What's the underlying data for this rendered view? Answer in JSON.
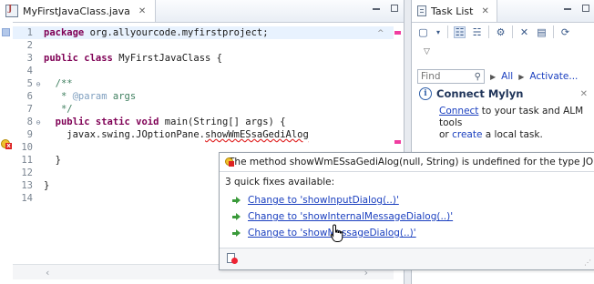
{
  "editor": {
    "tab_label": "MyFirstJavaClass.java",
    "tab_close": "✕",
    "lines": [
      {
        "n": "1",
        "fold": "",
        "segments": [
          {
            "t": "package ",
            "c": "kw"
          },
          {
            "t": "org.allyourcode.myfirstproject;",
            "c": ""
          }
        ]
      },
      {
        "n": "2",
        "fold": "",
        "segments": []
      },
      {
        "n": "3",
        "fold": "",
        "segments": [
          {
            "t": "public class ",
            "c": "kw"
          },
          {
            "t": "MyFirstJavaClass {",
            "c": ""
          }
        ]
      },
      {
        "n": "4",
        "fold": "",
        "segments": []
      },
      {
        "n": "5",
        "fold": "⊖",
        "segments": [
          {
            "t": "  /**",
            "c": "cm"
          }
        ]
      },
      {
        "n": "6",
        "fold": "",
        "segments": [
          {
            "t": "   * ",
            "c": "cm"
          },
          {
            "t": "@param",
            "c": "ann"
          },
          {
            "t": " args",
            "c": "cm"
          }
        ]
      },
      {
        "n": "7",
        "fold": "",
        "segments": [
          {
            "t": "   */",
            "c": "cm"
          }
        ]
      },
      {
        "n": "8",
        "fold": "⊖",
        "segments": [
          {
            "t": "  public static void ",
            "c": "kw"
          },
          {
            "t": "main(String[] args) {",
            "c": ""
          }
        ]
      },
      {
        "n": "9",
        "fold": "",
        "segments": [
          {
            "t": "    javax.swing.JOptionPane.",
            "c": ""
          },
          {
            "t": "showWmESsaGediAlog",
            "c": "err"
          }
        ]
      },
      {
        "n": "10",
        "fold": "",
        "segments": []
      },
      {
        "n": "11",
        "fold": "",
        "segments": [
          {
            "t": "  }",
            "c": ""
          }
        ]
      },
      {
        "n": "12",
        "fold": "",
        "segments": []
      },
      {
        "n": "13",
        "fold": "",
        "segments": [
          {
            "t": "}",
            "c": ""
          }
        ]
      },
      {
        "n": "14",
        "fold": "",
        "segments": []
      }
    ]
  },
  "tasklist": {
    "tab_label": "Task List",
    "tab_close": "✕",
    "find_placeholder": "Find",
    "all_label": "All",
    "activate_label": "Activate...",
    "mylyn": {
      "title": "Connect Mylyn",
      "close": "✕",
      "connect_link": "Connect",
      "text1": " to your task and ALM tools",
      "or_text": "or ",
      "create_link": "create",
      "text2": " a local task."
    }
  },
  "quickfix": {
    "message": "The method showWmESsaGediAlog(null, String) is undefined for the type JOptionPane",
    "count_text": "3 quick fixes available:",
    "fixes": [
      {
        "label": "Change to 'showInputDialog(..)'"
      },
      {
        "label": "Change to 'showInternalMessageDialog(..)'"
      },
      {
        "label": "Change to 'showMessageDialog(..)'"
      }
    ]
  },
  "colors": {
    "keyword": "#7f0055",
    "comment": "#3f7f5f",
    "link": "#1a3fbf",
    "error": "#e02020"
  }
}
